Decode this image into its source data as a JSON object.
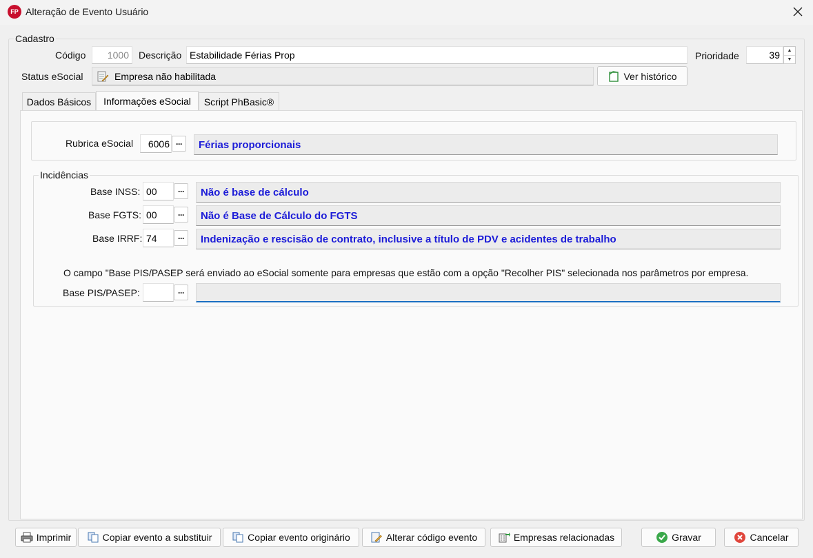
{
  "window": {
    "title": "Alteração de Evento Usuário",
    "app_icon_text": "FP"
  },
  "cadastro": {
    "legend": "Cadastro",
    "codigo_label": "Código",
    "codigo_value": "1000",
    "descricao_label": "Descrição",
    "descricao_value": "Estabilidade Férias Prop",
    "prioridade_label": "Prioridade",
    "prioridade_value": "39",
    "status_label": "Status eSocial",
    "status_value": "Empresa não habilitada",
    "historico_button": "Ver histórico"
  },
  "tabs": [
    {
      "label": "Dados Básicos"
    },
    {
      "label": "Informações eSocial"
    },
    {
      "label": "Script PhBasic®"
    }
  ],
  "esocial": {
    "rubrica_label": "Rubrica eSocial",
    "rubrica_code": "6006",
    "rubrica_desc": "Férias proporcionais",
    "incidencias_legend": "Incidências",
    "inss_label": "Base INSS:",
    "inss_code": "00",
    "inss_desc": "Não é base de cálculo",
    "fgts_label": "Base FGTS:",
    "fgts_code": "00",
    "fgts_desc": "Não é Base de Cálculo do FGTS",
    "irrf_label": "Base IRRF:",
    "irrf_code": "74",
    "irrf_desc": "Indenização e rescisão de contrato, inclusive a título de PDV e acidentes de trabalho",
    "pis_note": "O campo \"Base PIS/PASEP será enviado ao eSocial somente para empresas que estão com a opção \"Recolher PIS\" selecionada nos parâmetros por empresa.",
    "pis_label": "Base PIS/PASEP:",
    "pis_code": "",
    "pis_desc": "",
    "dots_label": "···"
  },
  "footer": {
    "imprimir": "Imprimir",
    "copiar_substituir": "Copiar evento a substituir",
    "copiar_originario": "Copiar evento originário",
    "alterar_codigo": "Alterar código evento",
    "empresas": "Empresas relacionadas",
    "gravar": "Gravar",
    "cancelar": "Cancelar"
  },
  "colors": {
    "accent_text": "#1c1cd8",
    "focus_underline": "#1a6fc2",
    "brand": "#c8102e"
  }
}
